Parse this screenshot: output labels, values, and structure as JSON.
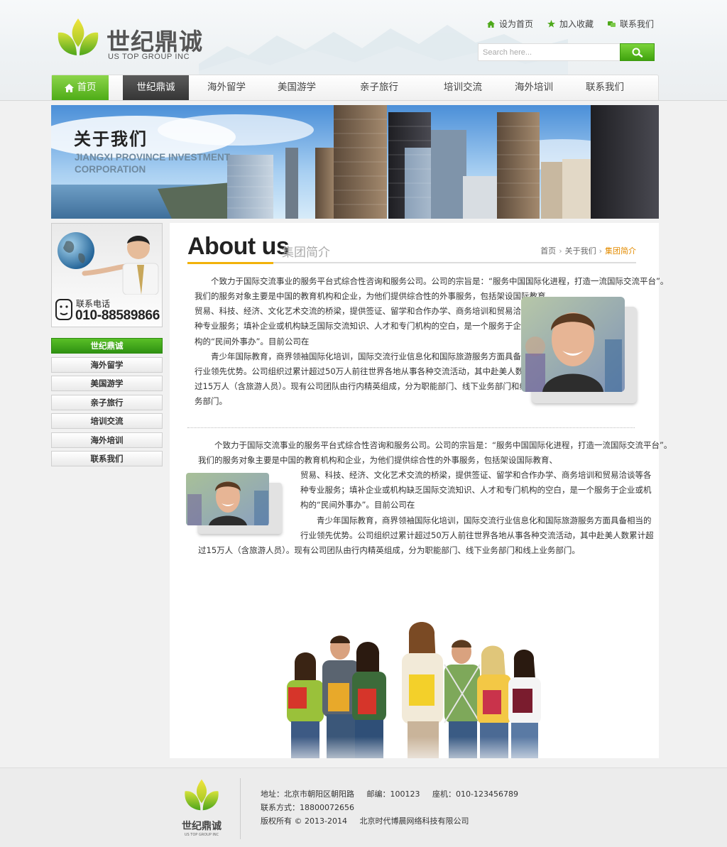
{
  "colors": {
    "brand_green": "#4eac17",
    "accent_orange": "#e38b00",
    "accent_yellow": "#f2b20a",
    "dark_tab": "#353535"
  },
  "header": {
    "logo_cn": "世纪鼎诚",
    "logo_en": "US TOP GROUP INC",
    "top_links": [
      {
        "label": "设为首页",
        "icon": "home-icon"
      },
      {
        "label": "加入收藏",
        "icon": "star-icon"
      },
      {
        "label": "联系我们",
        "icon": "contact-icon"
      }
    ],
    "search": {
      "placeholder": "Search here...",
      "button_icon": "search-icon"
    }
  },
  "nav": {
    "items": [
      "首页",
      "世纪鼎诚",
      "海外留学",
      "美国游学",
      "亲子旅行",
      "培训交流",
      "海外培训",
      "联系我们"
    ],
    "active": "世纪鼎诚",
    "home_icon": "home-icon"
  },
  "banner": {
    "title": "关于我们",
    "subtitle_line1": "JIANGXI PROVINCE INVESTMENT",
    "subtitle_line2": "CORPORATION"
  },
  "sidebar": {
    "contact_label": "联系电话",
    "contact_phone": "010-88589866",
    "menu": [
      "世纪鼎诚",
      "海外留学",
      "美国游学",
      "亲子旅行",
      "培训交流",
      "海外培训",
      "联系我们"
    ],
    "active": "世纪鼎诚"
  },
  "main": {
    "title_en": "About us",
    "title_cn": "集团简介",
    "breadcrumb": [
      "首页",
      "关于我们",
      "集团简介"
    ],
    "section1": {
      "lines": [
        "　　个致力于国际交流事业的服务平台式综合性咨询和服务公司。公司的宗旨是：“服务中国国际化进程，打造一流国际交流平台”。",
        "我们的服务对象主要是中国的教育机构和企业，为他们提供综合性的外事服务，包括架设国际教育、",
        "贸易、科技、经济、文化艺术交流的桥梁，提供签证、留学和合作办学、商务培训和贸易洽谈等各",
        "种专业服务；填补企业或机构缺乏国际交流知识、人才和专门机构的空白，是一个服务于企业或机",
        "构的“民间外事办”。目前公司在",
        "　　青少年国际教育，商界领袖国际化培训，国际交流行业信息化和国际旅游服务方面具备相当的",
        "行业领先优势。公司组织过累计超过50万人前往世界各地从事各种交流活动，其中赴美人数累计超",
        "过15万人（含旅游人员）。现有公司团队由行内精英组成，分为职能部门、线下业务部门和线上业",
        "务部门。"
      ]
    },
    "section2": {
      "lines_top": [
        "　　个致力于国际交流事业的服务平台式综合性咨询和服务公司。公司的宗旨是：“服务中国国际化进程，打造一流国际交流平台”。",
        "我们的服务对象主要是中国的教育机构和企业，为他们提供综合性的外事服务，包括架设国际教育、"
      ],
      "lines_side": [
        "贸易、科技、经济、文化艺术交流的桥梁，提供签证、留学和合作办学、商务培训和贸易洽谈等各",
        "种专业服务；填补企业或机构缺乏国际交流知识、人才和专门机构的空白，是一个服务于企业或机",
        "构的“民间外事办”。目前公司在",
        "　　青少年国际教育，商界领袖国际化培训，国际交流行业信息化和国际旅游服务方面具备相当的",
        "行业领先优势。公司组织过累计超过50万人前往世界各地从事各种交流活动，其中赴美人数累计超"
      ],
      "lines_bottom": [
        "过15万人（含旅游人员）。现有公司团队由行内精英组成，分为职能部门、线下业务部门和线上业务部门。"
      ]
    }
  },
  "footer": {
    "logo_cn": "世纪鼎诚",
    "logo_en": "US TOP GROUP INC",
    "address": "地址：北京市朝阳区朝阳路",
    "postcode": "邮编：100123",
    "phone": "座机：010-123456789",
    "contact": "联系方式：18800072656",
    "copyright": "版权所有 © 2013-2014",
    "company": "北京时代博晨网络科技有限公司"
  }
}
